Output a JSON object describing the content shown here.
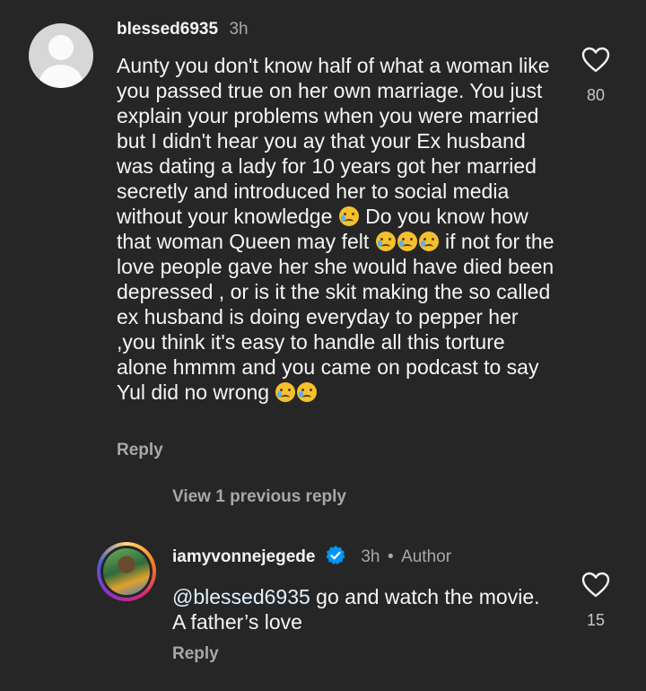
{
  "comment1": {
    "username": "blessed6935",
    "time": "3h",
    "text_parts": [
      "Aunty you don't know half of what a woman like you passed true on her own marriage. You just explain your problems when you were married but I didn't hear you ay that your Ex husband  was dating a lady for 10 years got her married secretly and introduced her to social media without your knowledge ",
      " Do you know how that woman Queen may felt ",
      " if not for the love people gave her she would have died been depressed , or is it the skit making the so called ex husband is doing everyday to pepper her ,you think it's easy to handle all this torture alone hmmm and you came on podcast to say Yul did no wrong "
    ],
    "emoji_name": "crying-face",
    "like_count": "80",
    "reply_label": "Reply"
  },
  "view_replies_label": "View 1 previous reply",
  "comment2": {
    "username": "iamyvonnejegede",
    "time": "3h",
    "separator": "•",
    "author_label": "Author",
    "mention": "@blessed6935",
    "text": " go and watch the movie. A father’s love",
    "like_count": "15",
    "reply_label": "Reply"
  },
  "colors": {
    "background": "#262626",
    "text_primary": "#f5f5f5",
    "text_secondary": "#a8a8a8",
    "verified_blue": "#0095f6"
  },
  "icons": {
    "like": "heart-outline-icon",
    "verified": "verified-badge-icon",
    "avatar_default": "default-avatar-icon"
  }
}
